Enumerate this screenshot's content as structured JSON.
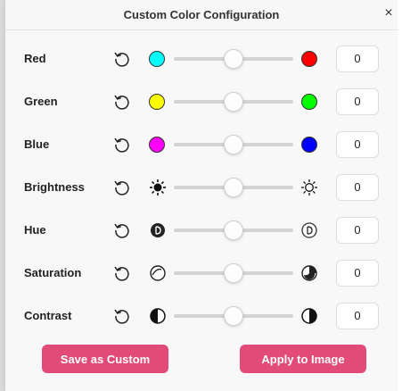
{
  "dialog": {
    "title": "Custom Color Configuration",
    "close_glyph": "×"
  },
  "rows": [
    {
      "label": "Red",
      "value": "0",
      "left_color": "#00ffff",
      "right_color": "#ff0000"
    },
    {
      "label": "Green",
      "value": "0",
      "left_color": "#ffff00",
      "right_color": "#00ff00"
    },
    {
      "label": "Blue",
      "value": "0",
      "left_color": "#ff00ff",
      "right_color": "#0000ff"
    },
    {
      "label": "Brightness",
      "value": "0",
      "left_icon": "sun-filled-icon",
      "right_icon": "sun-outline-icon"
    },
    {
      "label": "Hue",
      "value": "0",
      "left_icon": "hue-dark-icon",
      "right_icon": "hue-light-icon"
    },
    {
      "label": "Saturation",
      "value": "0",
      "left_icon": "saturation-low-icon",
      "right_icon": "saturation-high-icon"
    },
    {
      "label": "Contrast",
      "value": "0",
      "left_icon": "contrast-low-icon",
      "right_icon": "contrast-high-icon"
    }
  ],
  "slider_level": 0.5,
  "buttons": {
    "save": "Save as Custom",
    "apply": "Apply to Image"
  },
  "colors": {
    "accent": "#e24b78",
    "track": "#d3d3d3"
  }
}
